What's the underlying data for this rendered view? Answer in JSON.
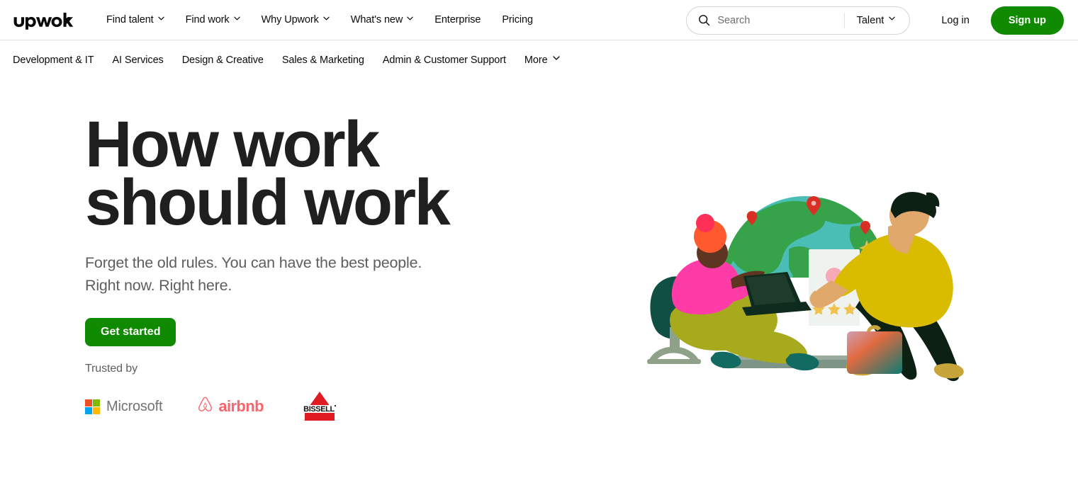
{
  "header": {
    "logo_alt": "Upwork",
    "nav": [
      {
        "label": "Find talent",
        "has_dropdown": true
      },
      {
        "label": "Find work",
        "has_dropdown": true
      },
      {
        "label": "Why Upwork",
        "has_dropdown": true
      },
      {
        "label": "What's new",
        "has_dropdown": true
      },
      {
        "label": "Enterprise",
        "has_dropdown": false
      },
      {
        "label": "Pricing",
        "has_dropdown": false
      }
    ],
    "search": {
      "placeholder": "Search",
      "value": "",
      "scope_label": "Talent"
    },
    "login_label": "Log in",
    "signup_label": "Sign up"
  },
  "category_nav": {
    "items": [
      {
        "label": "Development & IT",
        "has_dropdown": false
      },
      {
        "label": "AI Services",
        "has_dropdown": false
      },
      {
        "label": "Design & Creative",
        "has_dropdown": false
      },
      {
        "label": "Sales & Marketing",
        "has_dropdown": false
      },
      {
        "label": "Admin & Customer Support",
        "has_dropdown": false
      },
      {
        "label": "More",
        "has_dropdown": true
      }
    ]
  },
  "hero": {
    "title_line1": "How work",
    "title_line2": "should work",
    "subtitle_line1": "Forget the old rules. You can have the best people.",
    "subtitle_line2": "Right now. Right here.",
    "cta_label": "Get started"
  },
  "trusted": {
    "label": "Trusted by",
    "brands": [
      {
        "name": "Microsoft",
        "wordmark": "Microsoft"
      },
      {
        "name": "Airbnb",
        "wordmark": "airbnb"
      },
      {
        "name": "Bissell",
        "wordmark": "BISSELL"
      }
    ]
  },
  "colors": {
    "brand_green": "#108a00",
    "text_primary": "#1f1f1f",
    "text_secondary": "#5e5e5e",
    "border": "#e4e4e4",
    "airbnb_red": "#f8656c",
    "bissell_red": "#e11b22",
    "microsoft_gray": "#737373"
  }
}
